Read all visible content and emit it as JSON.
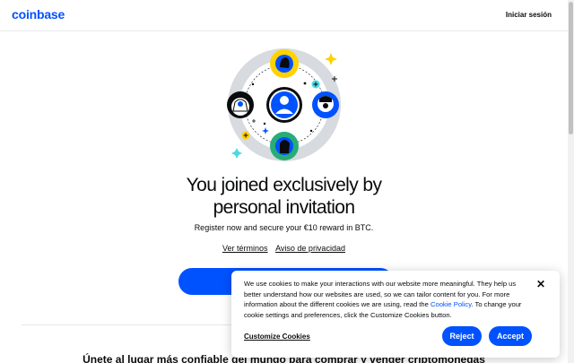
{
  "header": {
    "logo": "coinbase",
    "signin": "Iniciar sesión"
  },
  "hero": {
    "headline_line1": "You joined exclusively by",
    "headline_line2": "personal invitation",
    "subline": "Register now and secure your €10 reward in BTC.",
    "terms_link": "Ver términos",
    "privacy_link": "Aviso de privacidad"
  },
  "bottom": {
    "title": "Únete al lugar más confiable del mundo para comprar y vender criptomonedas"
  },
  "cookie_banner": {
    "text_part1": "We use cookies to make your interactions with our website more meaningful. They help us better understand how our websites are used, so we can tailor content for you. For more information about the different cookies we are using, read the",
    "policy_link": "Cookie Policy",
    "text_part2": ". To change your cookie settings and preferences, click the Customize Cookies button.",
    "customize_label": "Customize Cookies",
    "reject_label": "Reject",
    "accept_label": "Accept",
    "close_glyph": "✕"
  },
  "colors": {
    "brand": "#0052ff",
    "yellow": "#ffd200",
    "green": "#27ad75",
    "cyan": "#4ad9e1",
    "ring": "#d7dadf"
  }
}
